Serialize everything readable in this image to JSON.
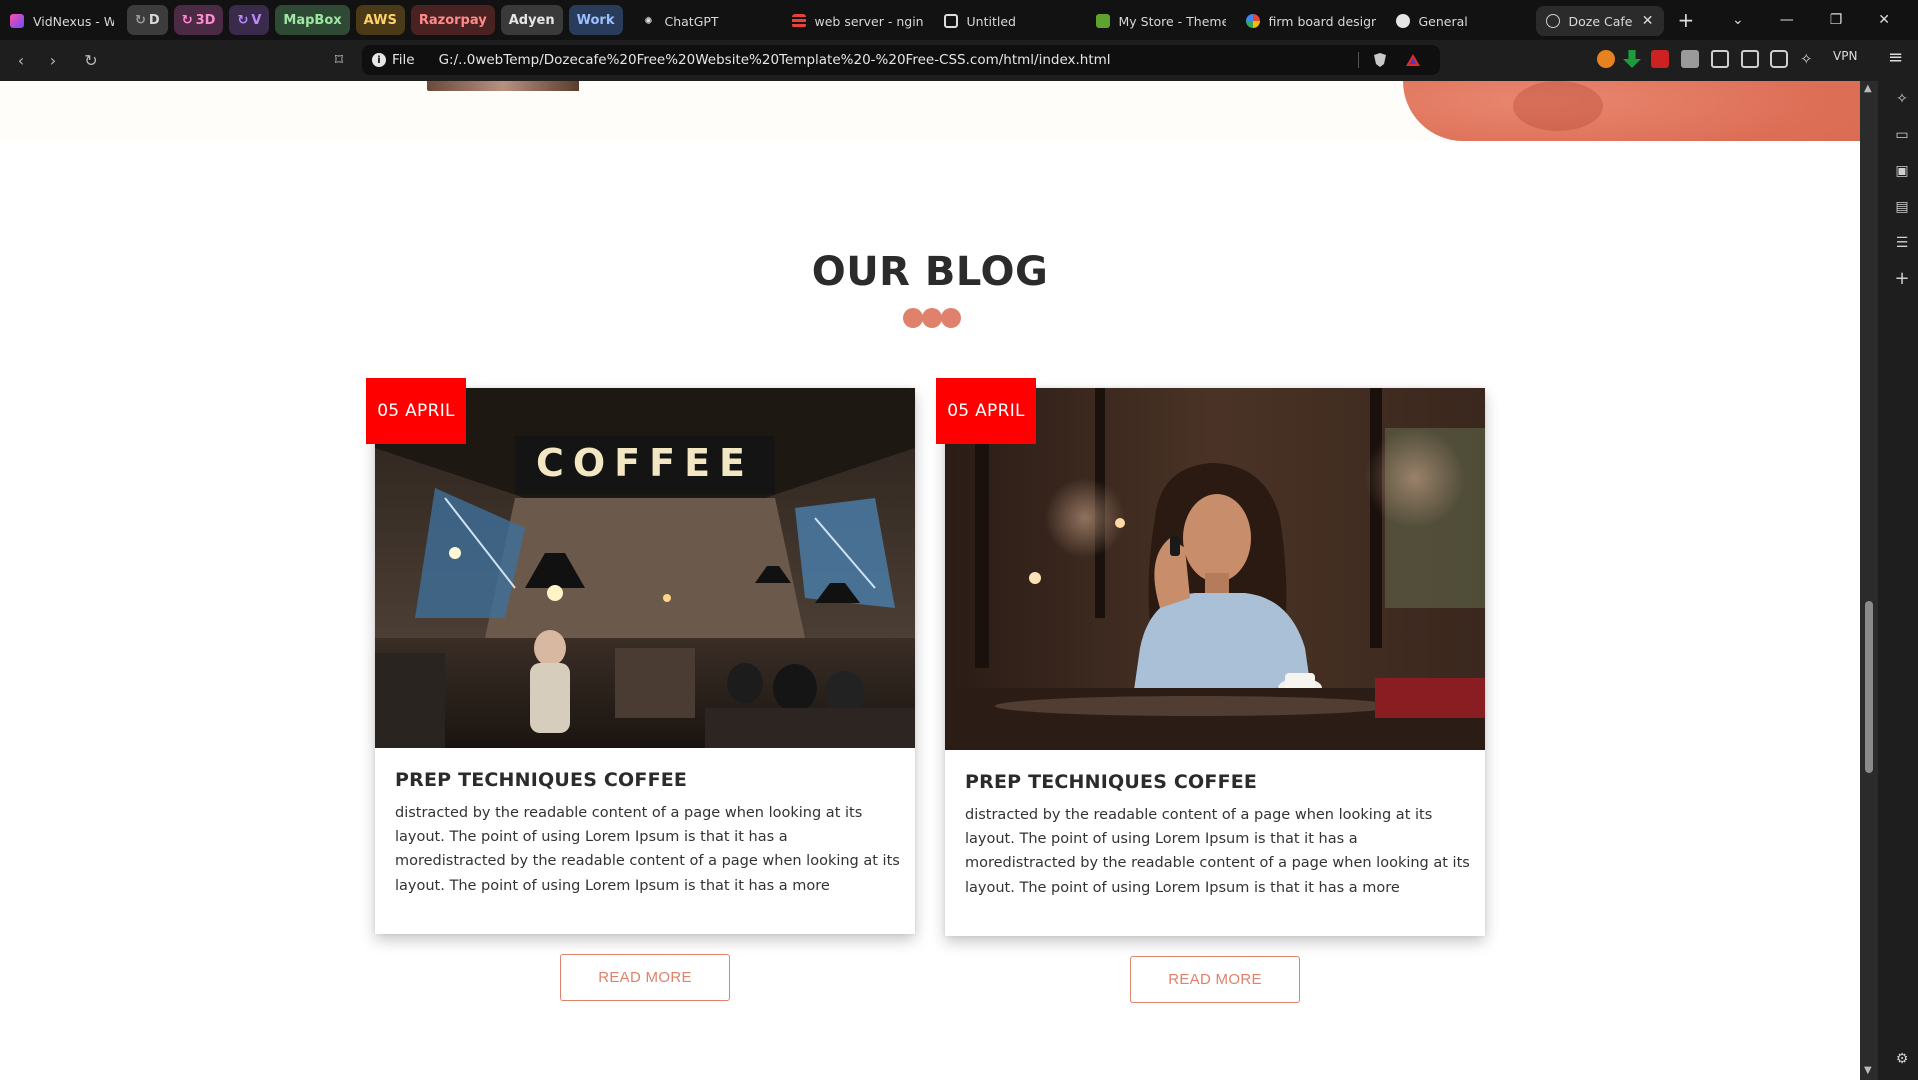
{
  "browser": {
    "tabs": [
      {
        "label": "VidNexus - Whiteb",
        "icon": "vidnexus-icon",
        "color": "#6b4bff"
      },
      {
        "label": "D",
        "group": true,
        "color": "#3c3c3c"
      },
      {
        "label": "3D",
        "group": true,
        "color": "#4a2a44"
      },
      {
        "label": "V",
        "group": true,
        "color": "#3a2a4c"
      },
      {
        "label": "MapBox",
        "group": true,
        "color": "#2f4a34"
      },
      {
        "label": "AWS",
        "group": true,
        "color": "#4a3a18"
      },
      {
        "label": "Razorpay",
        "group": true,
        "color": "#4a2222"
      },
      {
        "label": "Adyen",
        "group": true,
        "color": "#3a3a3a"
      },
      {
        "label": "Work",
        "group": true,
        "color": "#2a3c5c"
      },
      {
        "label": "ChatGPT",
        "icon": "chatgpt-icon"
      },
      {
        "label": "web server - nginx",
        "icon": "stackoverflow-icon"
      },
      {
        "label": "Untitled",
        "icon": "codepen-icon"
      },
      {
        "label": "My Store - Themes",
        "icon": "shopify-icon"
      },
      {
        "label": "firm board design",
        "icon": "google-icon"
      },
      {
        "label": "General",
        "icon": "github-icon"
      },
      {
        "label": "Doze Cafe",
        "icon": "globe-icon",
        "active": true
      }
    ],
    "new_tab": "+",
    "address": {
      "scheme": "File",
      "url": "G:/..0webTemp/Dozecafe%20Free%20Website%20Template%20-%20Free-CSS.com/html/index.html"
    },
    "vpn_label": "VPN"
  },
  "blog": {
    "heading": "OUR BLOG",
    "accent": "#e0826b",
    "badge_color": "#ff0000",
    "posts": [
      {
        "date": "05 APRIL",
        "title": "PREP TECHNIQUES COFFEE",
        "text": "distracted by the readable content of a page when looking at its layout. The point of using Lorem Ipsum is that it has a moredistracted by the readable content of a page when looking at its layout. The point of using Lorem Ipsum is that it has a more",
        "image_sign": "COFFEE",
        "button": "READ MORE"
      },
      {
        "date": "05 APRIL",
        "title": "PREP TECHNIQUES COFFEE",
        "text": "distracted by the readable content of a page when looking at its layout. The point of using Lorem Ipsum is that it has a moredistracted by the readable content of a page when looking at its layout. The point of using Lorem Ipsum is that it has a more",
        "button": "READ MORE"
      }
    ]
  }
}
